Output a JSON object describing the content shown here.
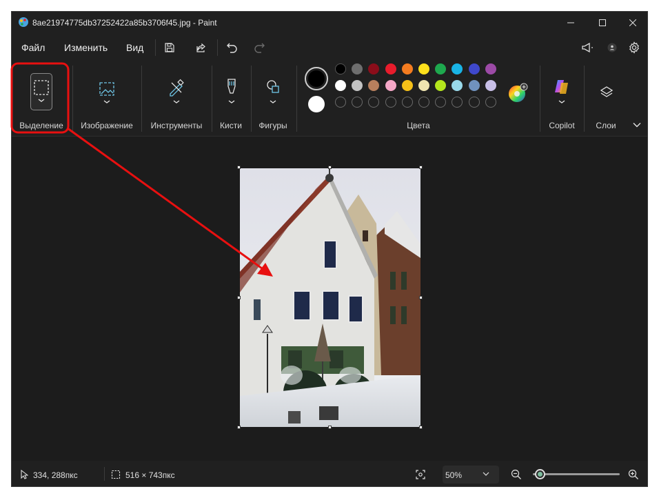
{
  "window": {
    "title": "8ae21974775db37252422a85b3706f45.jpg - Paint",
    "controls": [
      "minimize-icon",
      "maximize-icon",
      "close-icon"
    ]
  },
  "menu": {
    "file": "Файл",
    "edit": "Изменить",
    "view": "Вид"
  },
  "quick_actions": [
    "save-icon",
    "share-icon",
    "undo-icon",
    "redo-icon"
  ],
  "right_actions": [
    "feedback-icon",
    "account-icon",
    "settings-icon"
  ],
  "ribbon": {
    "selection": "Выделение",
    "image": "Изображение",
    "tools": "Инструменты",
    "brushes": "Кисти",
    "shapes": "Фигуры",
    "colors": "Цвета",
    "copilot": "Copilot",
    "layers": "Слои"
  },
  "colors": {
    "primary": "#000000",
    "secondary": "#ffffff",
    "row1": [
      "#000000",
      "#6e6e6e",
      "#8b0d1a",
      "#e81c2c",
      "#f47c20",
      "#fde01c",
      "#1ea84e",
      "#19b4e6",
      "#3f48cc",
      "#9c4aa6"
    ],
    "row2": [
      "#ffffff",
      "#c3c3c3",
      "#b77f5d",
      "#f5a8c8",
      "#f5c018",
      "#efe4b0",
      "#b5e61d",
      "#99d9ea",
      "#7092be",
      "#c8bfe7"
    ],
    "row3_empty": 10,
    "accent": "#7dbd9e",
    "highlight": "#e81010"
  },
  "status": {
    "cursor_pos": "334, 288пкс",
    "selection_size": "516 × 743пкс",
    "zoom": "50%"
  },
  "zoom_slider": {
    "level": 0.05
  }
}
